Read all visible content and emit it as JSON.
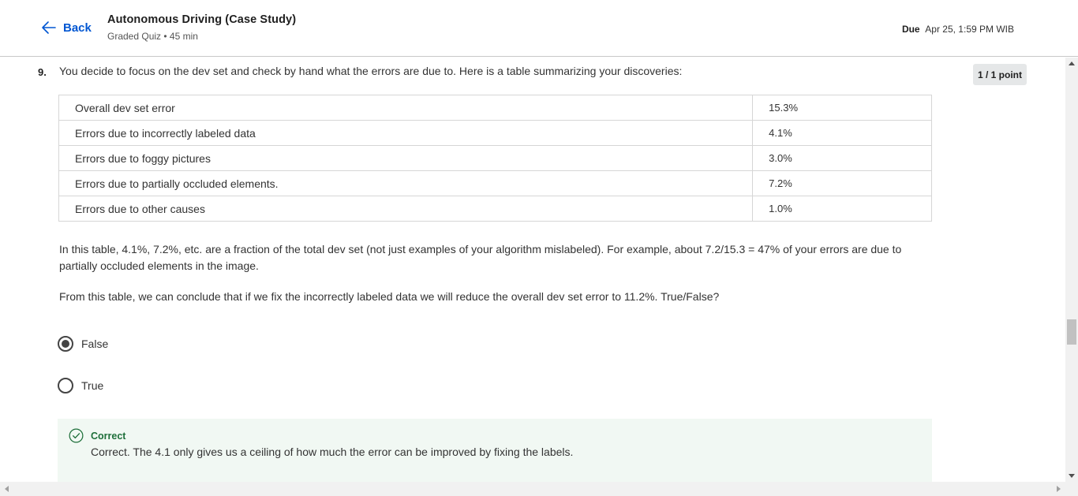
{
  "header": {
    "back_label": "Back",
    "course_title": "Autonomous Driving (Case Study)",
    "subtitle": "Graded Quiz • 45 min",
    "due_label": "Due",
    "due_value": "Apr 25, 1:59 PM WIB"
  },
  "question": {
    "number": "9.",
    "text": "You decide to focus on the dev set and check by hand what the errors are due to. Here is a table summarizing your discoveries:",
    "points": "1 / 1 point",
    "table": [
      {
        "label": "Overall dev set error",
        "value": "15.3%"
      },
      {
        "label": "Errors due to incorrectly labeled data",
        "value": "4.1%"
      },
      {
        "label": "Errors due to foggy pictures",
        "value": "3.0%"
      },
      {
        "label": "Errors due to partially occluded elements.",
        "value": "7.2%"
      },
      {
        "label": "Errors due to other causes",
        "value": "1.0%"
      }
    ],
    "paragraph1": "In this table, 4.1%, 7.2%, etc. are a fraction of the total dev set (not just examples of your algorithm mislabeled). For example, about 7.2/15.3 = 47% of your errors are due to partially occluded elements in the image.",
    "paragraph2": "From this table, we can conclude that if we fix the incorrectly labeled data we will reduce the overall dev set error to 11.2%. True/False?",
    "options": [
      {
        "label": "False",
        "selected": true
      },
      {
        "label": "True",
        "selected": false
      }
    ],
    "feedback": {
      "title": "Correct",
      "text": "Correct. The 4.1 only gives us a ceiling of how much the error can be improved by fixing the labels."
    }
  },
  "colors": {
    "accent": "#0056d2",
    "correct": "#1e6f3a",
    "feedback_bg": "#f1f8f3"
  },
  "icons": {
    "back": "arrow-left-icon",
    "correct": "check-circle-icon"
  }
}
